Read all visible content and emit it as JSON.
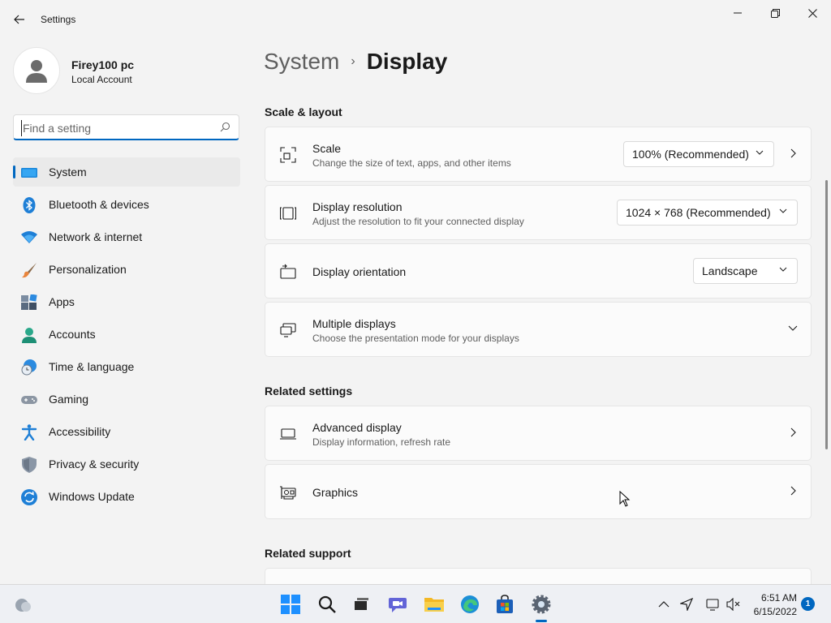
{
  "window": {
    "title": "Settings"
  },
  "profile": {
    "name": "Firey100 pc",
    "account_type": "Local Account"
  },
  "search": {
    "placeholder": "Find a setting"
  },
  "sidebar": {
    "items": [
      {
        "label": "System",
        "icon": "system-icon",
        "active": true
      },
      {
        "label": "Bluetooth & devices",
        "icon": "bluetooth-icon"
      },
      {
        "label": "Network & internet",
        "icon": "wifi-icon"
      },
      {
        "label": "Personalization",
        "icon": "brush-icon"
      },
      {
        "label": "Apps",
        "icon": "apps-icon"
      },
      {
        "label": "Accounts",
        "icon": "accounts-icon"
      },
      {
        "label": "Time & language",
        "icon": "time-language-icon"
      },
      {
        "label": "Gaming",
        "icon": "gamepad-icon"
      },
      {
        "label": "Accessibility",
        "icon": "accessibility-icon"
      },
      {
        "label": "Privacy & security",
        "icon": "shield-icon"
      },
      {
        "label": "Windows Update",
        "icon": "update-icon"
      }
    ]
  },
  "breadcrumb": {
    "parent": "System",
    "separator": "›",
    "current": "Display"
  },
  "sections": {
    "scale_layout": "Scale & layout",
    "related_settings": "Related settings",
    "related_support": "Related support"
  },
  "cards": {
    "scale": {
      "title": "Scale",
      "subtitle": "Change the size of text, apps, and other items",
      "value": "100% (Recommended)"
    },
    "resolution": {
      "title": "Display resolution",
      "subtitle": "Adjust the resolution to fit your connected display",
      "value": "1024 × 768 (Recommended)"
    },
    "orientation": {
      "title": "Display orientation",
      "value": "Landscape"
    },
    "multiple": {
      "title": "Multiple displays",
      "subtitle": "Choose the presentation mode for your displays"
    },
    "advanced": {
      "title": "Advanced display",
      "subtitle": "Display information, refresh rate"
    },
    "graphics": {
      "title": "Graphics"
    }
  },
  "taskbar": {
    "time": "6:51 AM",
    "date": "6/15/2022",
    "notifications": "1"
  },
  "colors": {
    "accent": "#0067c0",
    "background": "#f3f3f3",
    "card": "#fbfbfb"
  }
}
